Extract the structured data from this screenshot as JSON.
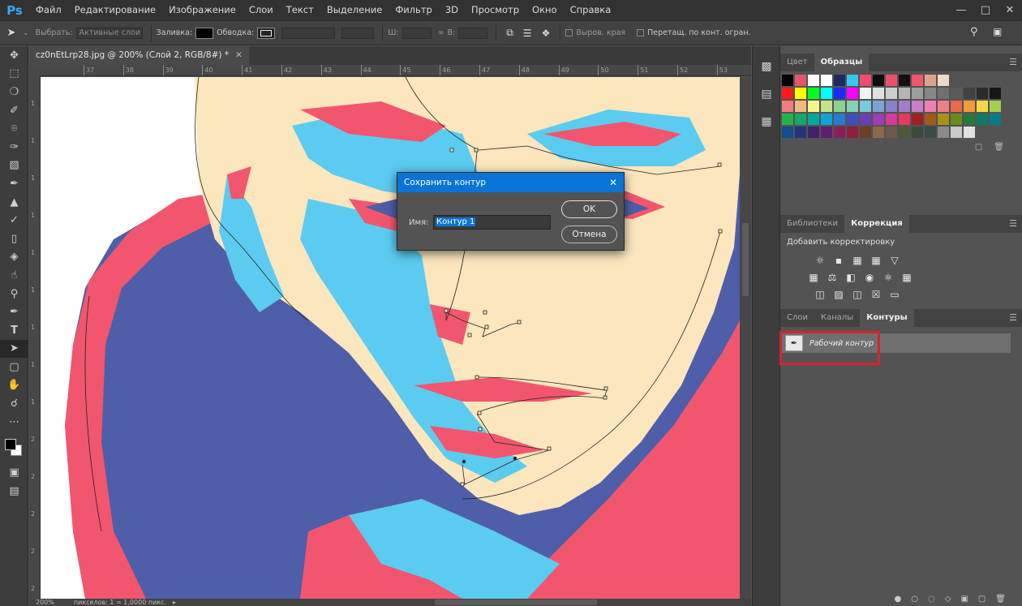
{
  "app": {
    "logo": "Ps",
    "menu": [
      "Файл",
      "Редактирование",
      "Изображение",
      "Слои",
      "Текст",
      "Выделение",
      "Фильтр",
      "3D",
      "Просмотр",
      "Окно",
      "Справка"
    ],
    "window_controls": [
      "minimize-icon",
      "maximize-icon",
      "close-icon"
    ]
  },
  "options": {
    "select_label": "Выбрать:",
    "select_value": "Активные слои",
    "fill_label": "Заливка:",
    "stroke_label": "Обводка:",
    "w_label": "Ш:",
    "h_label": "В:",
    "align_edges": "Выров. края",
    "constrain": "Перетащ. по конт. огран."
  },
  "document": {
    "tab_title": "cz0nEtLrp28.jpg @ 200% (Слой 2, RGB/8#) *",
    "ruler_top": [
      "37",
      "38",
      "39",
      "40",
      "41",
      "42",
      "43",
      "44",
      "45",
      "46",
      "47",
      "48",
      "49",
      "50",
      "51",
      "52",
      "53"
    ],
    "ruler_left": [
      "1",
      "1",
      "1",
      "1",
      "1",
      "1",
      "1",
      "1",
      "1",
      "2",
      "2",
      "2",
      "2",
      "2"
    ],
    "zoom": "200%",
    "status": "пикселов: 1 = 1,0000 пикс."
  },
  "swatches_panel": {
    "tabs": [
      "Цвет",
      "Образцы"
    ],
    "active_tab": "Образцы",
    "rows": [
      [
        "#000000",
        "#e8546a",
        "#ffffff",
        "#ffffff",
        "#1e2a5e",
        "#36c7ef",
        "#ef4d6d",
        "#0d0d0d",
        "#ef4d6d",
        "#121212",
        "#f2566e",
        "#d9a48a",
        "#f0d8c4"
      ],
      [
        "#ff1a1a",
        "#ffff00",
        "#00ff22",
        "#00ffff",
        "#1a2bff",
        "#ff00ff",
        "#f2f2f2",
        "#e0e0e0",
        "#cccccc",
        "#b5b5b5",
        "#9e9e9e",
        "#878787",
        "#707070",
        "#595959",
        "#424242",
        "#2b2b2b",
        "#171717"
      ],
      [
        "#ef7e7e",
        "#f3b882",
        "#f8f38c",
        "#c8e28c",
        "#8cd38a",
        "#86d2b4",
        "#79cbd9",
        "#7da3d6",
        "#8482c8",
        "#a07fc8",
        "#c87fc6",
        "#ef7fb1",
        "#ee7f87",
        "#e86a4a",
        "#f29a3c",
        "#f7d74a",
        "#a5cf50"
      ],
      [
        "#22b24c",
        "#15a86a",
        "#00a99a",
        "#0fa3d9",
        "#2a7ad1",
        "#3f4fba",
        "#6a3fb4",
        "#9b3fb1",
        "#d6399a",
        "#e8395f",
        "#9e1f1f",
        "#a05a1a",
        "#a8921a",
        "#6a8a1f",
        "#23783a",
        "#0e7a63",
        "#087a8a"
      ],
      [
        "#134c8c",
        "#25347a",
        "#3f226e",
        "#5f1f6e",
        "#861f5a",
        "#8c1f3d",
        "#6b3f2a",
        "#8a6a4a",
        "#6a5a4a",
        "#4a5a3a",
        "#3a4a3a",
        "#3a4a4a",
        "#8a8a8a",
        "#c8c8c8",
        "#e0e0e0"
      ]
    ]
  },
  "adjust_panel": {
    "tabs": [
      "Библиотеки",
      "Коррекция"
    ],
    "active_tab": "Коррекция",
    "title": "Добавить корректировку",
    "row1": [
      "brightness-icon",
      "levels-icon",
      "curves-icon",
      "exposure-icon",
      "vibrance-icon"
    ],
    "row2": [
      "hue-saturation-icon",
      "color-balance-icon",
      "black-white-icon",
      "photo-filter-icon",
      "channel-mixer-icon",
      "color-lookup-icon"
    ],
    "row3": [
      "invert-icon",
      "posterize-icon",
      "threshold-icon",
      "selective-color-icon",
      "gradient-map-icon"
    ]
  },
  "paths_panel": {
    "tabs": [
      "Слои",
      "Каналы",
      "Контуры"
    ],
    "active_tab": "Контуры",
    "work_path": "Рабочий контур"
  },
  "dialog": {
    "title": "Сохранить контур",
    "name_label": "Имя:",
    "name_value": "Контур 1",
    "ok": "OK",
    "cancel": "Отмена"
  },
  "colors": {
    "accent": "#0a74d6",
    "canvas_blue": "#4f5ea8",
    "canvas_pink": "#f2566e",
    "canvas_cyan": "#5ccbf0",
    "canvas_cream": "#fbe6bd",
    "highlight_red": "#d6242c"
  }
}
